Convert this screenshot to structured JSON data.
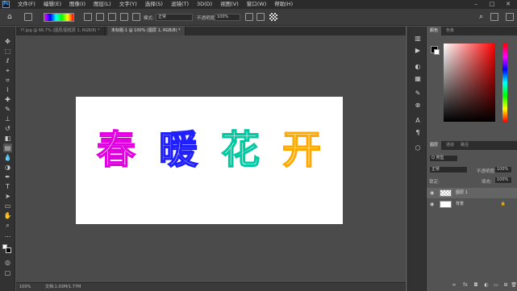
{
  "menubar": {
    "logo": "Ps",
    "items": [
      "文件(F)",
      "编辑(E)",
      "图像(I)",
      "图层(L)",
      "文字(Y)",
      "选择(S)",
      "滤镜(T)",
      "3D(D)",
      "视图(V)",
      "窗口(W)",
      "帮助(H)"
    ]
  },
  "options": {
    "mode_label": "模式:",
    "mode_value": "正常",
    "opacity_label": "不透明度:",
    "opacity_value": "100%"
  },
  "tabs": [
    {
      "label": "??.jpg @ 66.7% (图层/图框层 1, RGB/8) *",
      "active": false
    },
    {
      "label": "未标题-1 @ 100% (图层 1, RGB/8) *",
      "active": true
    }
  ],
  "canvas": {
    "chars": [
      "春",
      "暖",
      "花",
      "开"
    ],
    "colors": [
      "#e000ff",
      "#3030ff",
      "#00d0a0",
      "#ffb000"
    ]
  },
  "statusbar": {
    "zoom": "100%",
    "doc_size": "文档:1.03M/1.77M"
  },
  "color_panel": {
    "tabs": [
      "颜色",
      "色板"
    ]
  },
  "layers_panel": {
    "tabs": [
      "图层",
      "通道",
      "路径"
    ],
    "filter_label": "Q 类型",
    "blend_mode": "正常",
    "opacity_label": "不透明度:",
    "opacity_value": "100%",
    "lock_label": "锁定:",
    "fill_label": "填充:",
    "fill_value": "100%",
    "layers": [
      {
        "name": "图层 1",
        "selected": true,
        "locked": false
      },
      {
        "name": "背景",
        "selected": false,
        "locked": true
      }
    ]
  }
}
